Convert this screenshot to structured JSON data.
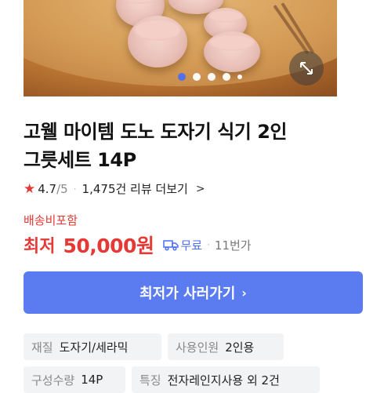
{
  "gallery": {
    "icons": {
      "expand": "expand-arrows-icon"
    },
    "dot_count": 5,
    "active_index": 0
  },
  "product": {
    "title_line1": "고웰 마이템 도노 도자기 식기 2인",
    "title_line2": "그릇세트 14P",
    "rating": "4.7",
    "rating_max": "/5",
    "review_count": "1,475건 리뷰 더보기",
    "rating_chevron": ">"
  },
  "pricing": {
    "shipping_note": "배송비포함",
    "price_label": "최저",
    "price": "50,000원",
    "shipping_free": "무료",
    "seller": "11번가"
  },
  "cta": {
    "label": "최저가 사러가기",
    "chevron": "›"
  },
  "specs": [
    {
      "key": "재질",
      "value": "도자기/세라믹"
    },
    {
      "key": "사용인원",
      "value": "2인용"
    },
    {
      "key": "구성수량",
      "value": "14P"
    },
    {
      "key": "특징",
      "value": "전자레인지사용 외 2건"
    }
  ],
  "colors": {
    "accent": "#e53935",
    "primary_button": "#5b7cf0",
    "free_shipping": "#4c6ef5"
  }
}
